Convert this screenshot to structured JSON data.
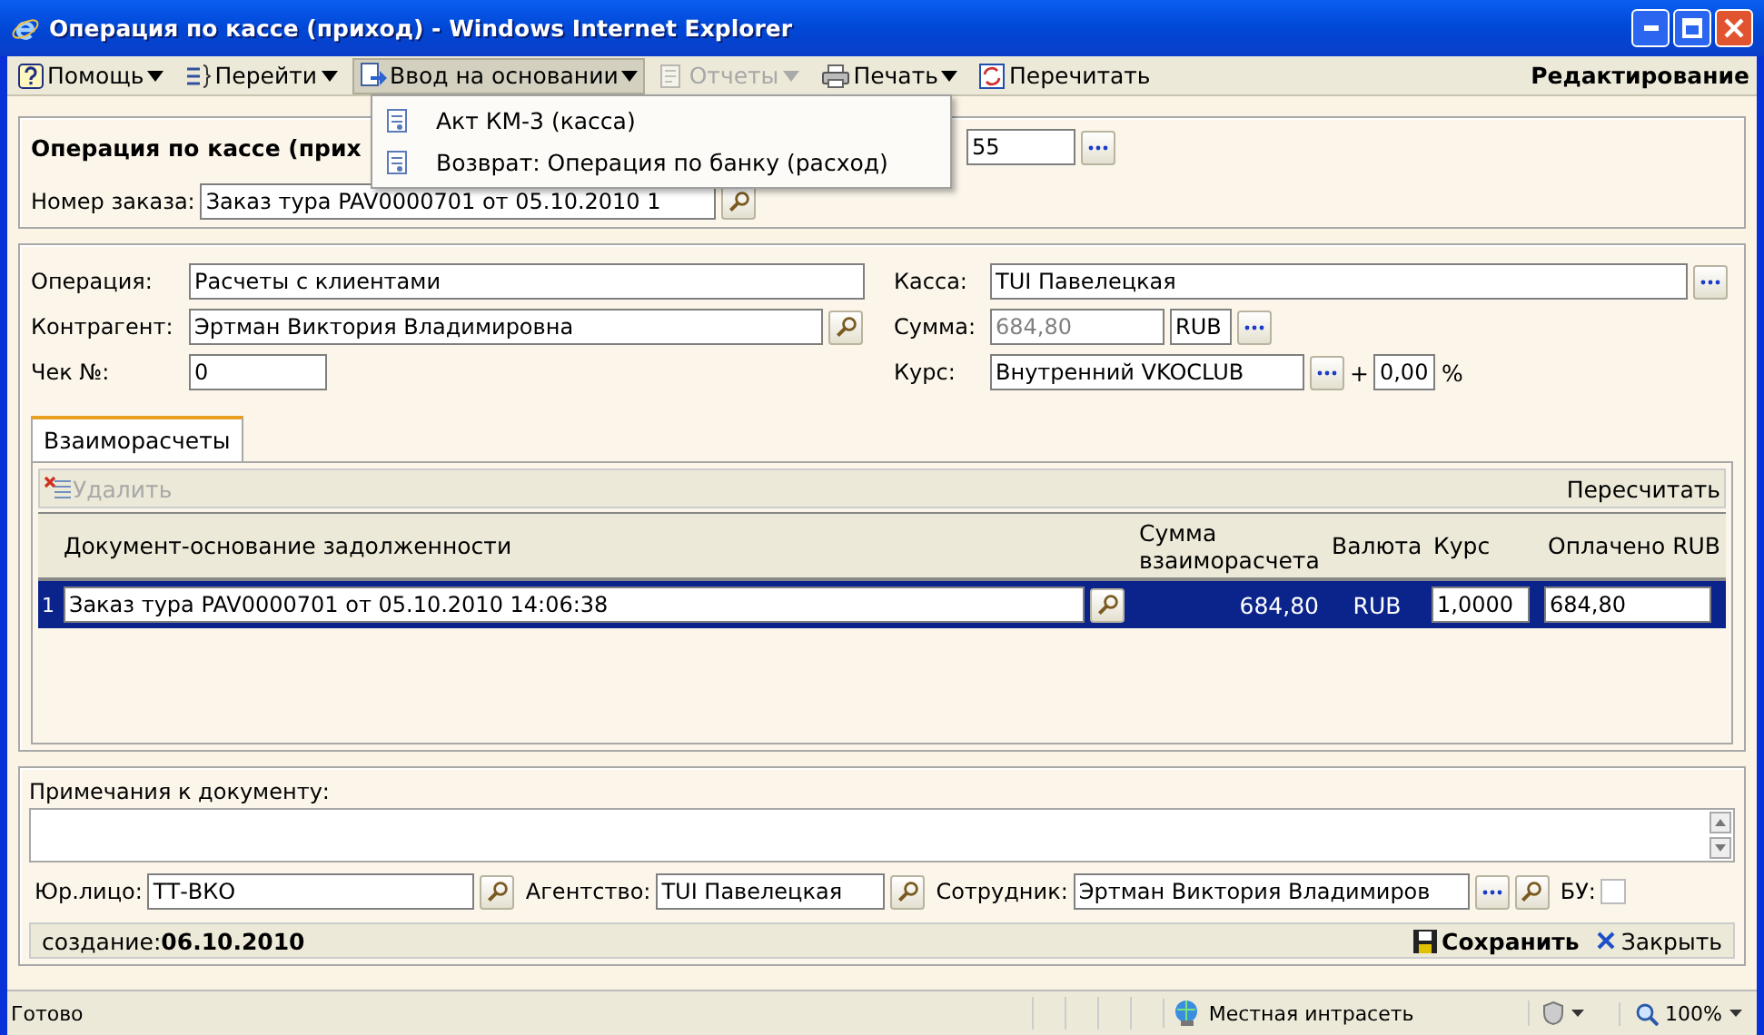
{
  "window": {
    "title": "Операция по кассе (приход) - Windows Internet Explorer"
  },
  "toolbar": {
    "items": [
      {
        "label": "Помощь",
        "kind": "help",
        "dropdown": true,
        "disabled": false
      },
      {
        "label": "Перейти",
        "kind": "goto",
        "dropdown": true,
        "disabled": false
      },
      {
        "label": "Ввод на основании",
        "kind": "create",
        "dropdown": true,
        "disabled": false,
        "selected": true
      },
      {
        "label": "Отчеты",
        "kind": "reports",
        "dropdown": true,
        "disabled": true
      },
      {
        "label": "Печать",
        "kind": "print",
        "dropdown": true,
        "disabled": false
      },
      {
        "label": "Перечитать",
        "kind": "refresh",
        "dropdown": false,
        "disabled": false
      }
    ],
    "mode": "Редактирование"
  },
  "menu": {
    "items": [
      {
        "label": "Акт КМ-3 (касса)"
      },
      {
        "label": "Возврат: Операция по банку (расход)"
      }
    ]
  },
  "header": {
    "title": "Операция по кассе (прих",
    "number": "55",
    "order_label": "Номер заказа:",
    "order_value": "Заказ тура PAV0000701 от 05.10.2010 1"
  },
  "fields": {
    "operation": {
      "label": "Операция:",
      "value": "Расчеты с клиентами"
    },
    "counterparty": {
      "label": "Контрагент:",
      "value": "Эртман Виктория Владимировна"
    },
    "check": {
      "label": "Чек №:",
      "value": "0"
    },
    "cashbox": {
      "label": "Касса:",
      "value": "TUI Павелецкая"
    },
    "sum": {
      "label": "Сумма:",
      "value": "684,80",
      "disabled": true,
      "currency": "RUB"
    },
    "rate": {
      "label": "Курс:",
      "value": "Внутренний VKOCLUB",
      "plus": "+",
      "percent_value": "0,00",
      "percent": "%"
    }
  },
  "tabs": [
    {
      "label": "Взаиморасчеты",
      "selected": true
    }
  ],
  "grid": {
    "delete": {
      "label": "Удалить",
      "disabled": true
    },
    "recalc": "Пересчитать",
    "columns": [
      "Документ-основание задолженности",
      "Сумма взаиморасчета",
      "Валюта",
      "Курс",
      "Оплачено RUB"
    ],
    "rows": [
      {
        "index": "1",
        "document": "Заказ тура PAV0000701 от 05.10.2010 14:06:38",
        "amount": "684,80",
        "currency": "RUB",
        "rate": "1,0000",
        "paid": "684,80",
        "selected": true
      }
    ]
  },
  "notes": {
    "label": "Примечания к документу:"
  },
  "legal": {
    "label": "Юр.лицо:",
    "value": "ТТ-ВКО"
  },
  "agency": {
    "label": "Агентство:",
    "value": "TUI Павелецкая"
  },
  "employee": {
    "label": "Сотрудник:",
    "value": "Эртман Виктория Владимиров"
  },
  "bu": {
    "label": "БУ:",
    "checked": false
  },
  "footer": {
    "created": "создание:**06.10.2010**",
    "save": "Сохранить",
    "close": "Закрыть"
  },
  "status_bar": {
    "text": "Готово",
    "zone": "Местная интрасеть",
    "zoom": "100%"
  }
}
